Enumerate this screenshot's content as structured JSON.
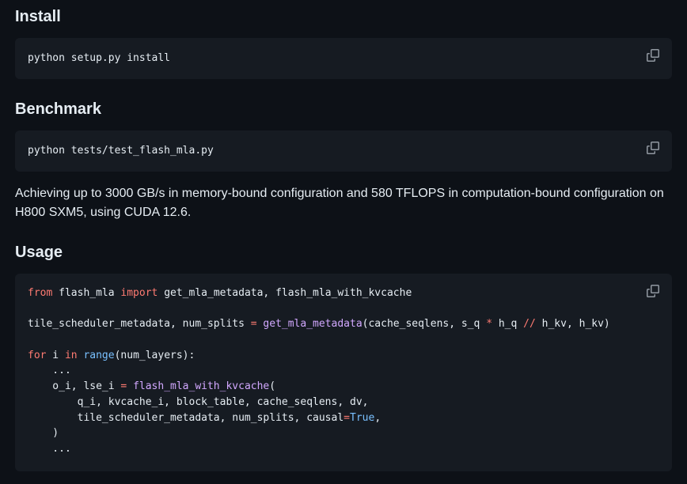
{
  "sections": {
    "install": {
      "heading": "Install",
      "code": "python setup.py install"
    },
    "benchmark": {
      "heading": "Benchmark",
      "code": "python tests/test_flash_mla.py",
      "description": "Achieving up to 3000 GB/s in memory-bound configuration and 580 TFLOPS in computation-bound configuration on H800 SXM5, using CUDA 12.6."
    },
    "usage": {
      "heading": "Usage",
      "code_lines": [
        [
          {
            "t": "from",
            "c": "kw"
          },
          {
            "t": " flash_mla "
          },
          {
            "t": "import",
            "c": "kw"
          },
          {
            "t": " get_mla_metadata, flash_mla_with_kvcache"
          }
        ],
        [],
        [
          {
            "t": "tile_scheduler_metadata, num_splits "
          },
          {
            "t": "=",
            "c": "op"
          },
          {
            "t": " "
          },
          {
            "t": "get_mla_metadata",
            "c": "fn"
          },
          {
            "t": "(cache_seqlens, s_q "
          },
          {
            "t": "*",
            "c": "op"
          },
          {
            "t": " h_q "
          },
          {
            "t": "//",
            "c": "op"
          },
          {
            "t": " h_kv, h_kv)"
          }
        ],
        [],
        [
          {
            "t": "for",
            "c": "kw"
          },
          {
            "t": " i "
          },
          {
            "t": "in",
            "c": "kw"
          },
          {
            "t": " "
          },
          {
            "t": "range",
            "c": "bi"
          },
          {
            "t": "(num_layers):"
          }
        ],
        [
          {
            "t": "    ..."
          }
        ],
        [
          {
            "t": "    o_i, lse_i "
          },
          {
            "t": "=",
            "c": "op"
          },
          {
            "t": " "
          },
          {
            "t": "flash_mla_with_kvcache",
            "c": "fn"
          },
          {
            "t": "("
          }
        ],
        [
          {
            "t": "        q_i, kvcache_i, block_table, cache_seqlens, dv,"
          }
        ],
        [
          {
            "t": "        tile_scheduler_metadata, num_splits, causal"
          },
          {
            "t": "=",
            "c": "op"
          },
          {
            "t": "True",
            "c": "cs"
          },
          {
            "t": ","
          }
        ],
        [
          {
            "t": "    )"
          }
        ],
        [
          {
            "t": "    ..."
          }
        ]
      ]
    }
  },
  "icons": {
    "copy": "copy-icon"
  },
  "colors": {
    "background": "#0d1117",
    "code_background": "#161b22",
    "text": "#e6edf3",
    "keyword": "#ff7b72",
    "function": "#d2a8ff",
    "constant": "#79c0ff",
    "icon": "#9198a1"
  }
}
